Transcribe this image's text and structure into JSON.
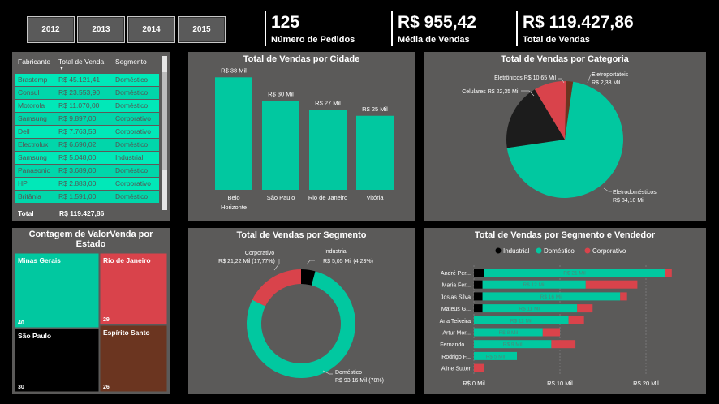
{
  "years": [
    "2012",
    "2013",
    "2014",
    "2015"
  ],
  "kpis": [
    {
      "value": "125",
      "label": "Número de Pedidos"
    },
    {
      "value": "R$ 955,42",
      "label": "Média de Vendas"
    },
    {
      "value": "R$ 119.427,86",
      "label": "Total de Vendas"
    }
  ],
  "table": {
    "headers": [
      "Fabricante",
      "Total de Venda",
      "Segmento"
    ],
    "rows": [
      [
        "Brastemp",
        "R$ 45.121,41",
        "Doméstico"
      ],
      [
        "Consul",
        "R$ 23.553,90",
        "Doméstico"
      ],
      [
        "Motorola",
        "R$ 11.070,00",
        "Doméstico"
      ],
      [
        "Samsung",
        "R$ 9.897,00",
        "Corporativo"
      ],
      [
        "Dell",
        "R$ 7.763,53",
        "Corporativo"
      ],
      [
        "Electrolux",
        "R$ 6.690,02",
        "Doméstico"
      ],
      [
        "Samsung",
        "R$ 5.048,00",
        "Industrial"
      ],
      [
        "Panasonic",
        "R$ 3.689,00",
        "Doméstico"
      ],
      [
        "HP",
        "R$ 2.883,00",
        "Corporativo"
      ],
      [
        "Britânia",
        "R$ 1.591,00",
        "Doméstico"
      ]
    ],
    "total_label": "Total",
    "total_value": "R$ 119.427,86"
  },
  "colors": {
    "teal": "#01c8a0",
    "red": "#d9434b",
    "black": "#1c1c1c",
    "brown": "#6b3520",
    "panel": "#5b5a59"
  },
  "chart_data": [
    {
      "type": "bar",
      "title": "Total de Vendas por Cidade",
      "categories": [
        "Belo Horizonte",
        "São Paulo",
        "Rio de Janeiro",
        "Vitória"
      ],
      "values": [
        38,
        30,
        27,
        25
      ],
      "data_labels": [
        "R$ 38 Mil",
        "R$ 30 Mil",
        "R$ 27 Mil",
        "R$ 25 Mil"
      ],
      "ylim": [
        0,
        40
      ]
    },
    {
      "type": "pie",
      "title": "Total de Vendas por Categoria",
      "slices": [
        {
          "name": "Eletrodomésticos",
          "value": 84.1,
          "label": "R$ 84,10 Mil",
          "color": "#01c8a0"
        },
        {
          "name": "Celulares",
          "value": 22.35,
          "label": "R$ 22,35 Mil",
          "color": "#1c1c1c"
        },
        {
          "name": "Eletrônicos",
          "value": 10.65,
          "label": "R$ 10,65 Mil",
          "color": "#d9434b"
        },
        {
          "name": "Eletroportáteis",
          "value": 2.33,
          "label": "R$ 2,33 Mil",
          "color": "#6b3520"
        }
      ]
    },
    {
      "type": "treemap",
      "title": "Contagem de ValorVenda por Estado",
      "items": [
        {
          "name": "Minas Gerais",
          "value": 40,
          "color": "#01c8a0"
        },
        {
          "name": "Rio de Janeiro",
          "value": 29,
          "color": "#d9434b"
        },
        {
          "name": "São Paulo",
          "value": 30,
          "color": "#000000"
        },
        {
          "name": "Espírito Santo",
          "value": 26,
          "color": "#6b3520"
        }
      ]
    },
    {
      "type": "pie",
      "title": "Total de Vendas por Segmento",
      "donut": true,
      "slices": [
        {
          "name": "Doméstico",
          "value": 93.16,
          "label": "R$ 93,16 Mil (78%)",
          "color": "#01c8a0"
        },
        {
          "name": "Corporativo",
          "value": 21.22,
          "label": "R$ 21,22 Mil (17,77%)",
          "color": "#d9434b"
        },
        {
          "name": "Industrial",
          "value": 5.05,
          "label": "R$ 5,05 Mil (4,23%)",
          "color": "#000000"
        }
      ]
    },
    {
      "type": "bar",
      "orientation": "horizontal",
      "stacked": true,
      "title": "Total de Vendas por Segmento e Vendedor",
      "legend": [
        "Industrial",
        "Doméstico",
        "Corporativo"
      ],
      "legend_position": "top",
      "categories": [
        "André Per...",
        "Maria Fer...",
        "Josias Silva",
        "Mateus G...",
        "Ana Teixeira",
        "Artur Mor...",
        "Fernando ...",
        "Rodrigo F...",
        "Aline Sutter"
      ],
      "series": [
        {
          "name": "Industrial",
          "color": "#000000",
          "values": [
            1.2,
            1.0,
            1.0,
            1.0,
            0,
            0,
            0,
            0,
            0
          ]
        },
        {
          "name": "Doméstico",
          "color": "#01c8a0",
          "values": [
            21,
            12,
            16,
            11,
            11,
            8,
            9,
            5,
            0
          ]
        },
        {
          "name": "Corporativo",
          "color": "#d9434b",
          "values": [
            0.8,
            6,
            0.8,
            1.8,
            1.8,
            2,
            2.8,
            0,
            1.2
          ]
        }
      ],
      "data_labels": [
        "R$ 21 Mil",
        "R$ 12 Mil",
        "R$ 16 Mil",
        "R$ 11 Mil",
        "R$ 11 Mil",
        "R$ 8 Mil",
        "R$ 9 Mil",
        "R$ 5 Mil",
        ""
      ],
      "xticks": [
        "R$ 0 Mil",
        "R$ 10 Mil",
        "R$ 20 Mil"
      ],
      "xlim": [
        0,
        22
      ]
    }
  ]
}
